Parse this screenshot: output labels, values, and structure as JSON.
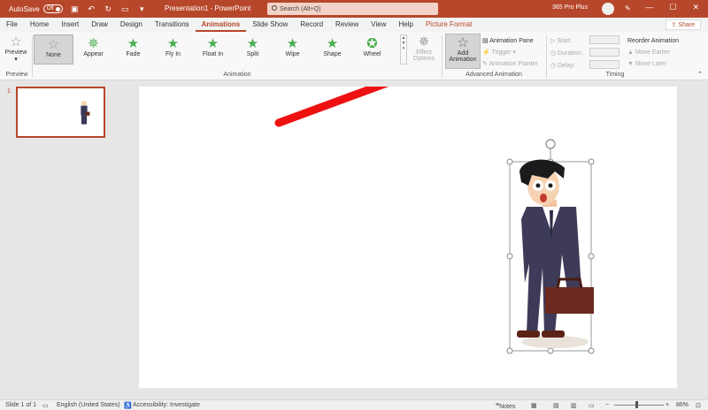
{
  "titlebar": {
    "autosave_label": "AutoSave",
    "autosave_state": "Off",
    "doc_title": "Presentation1 - PowerPoint",
    "search_placeholder": "Search (Alt+Q)",
    "account": "365 Pro Plus",
    "colors": {
      "accent": "#b7472a"
    }
  },
  "tabs": [
    "File",
    "Home",
    "Insert",
    "Draw",
    "Design",
    "Transitions",
    "Animations",
    "Slide Show",
    "Record",
    "Review",
    "View",
    "Help",
    "Picture Format"
  ],
  "active_tab": "Animations",
  "share_label": "Share",
  "ribbon": {
    "preview_label": "Preview",
    "preview_group": "Preview",
    "animations": [
      "None",
      "Appear",
      "Fade",
      "Fly In",
      "Float In",
      "Split",
      "Wipe",
      "Shape",
      "Wheel"
    ],
    "selected_animation": "None",
    "animation_group": "Animation",
    "effect_options": "Effect Options",
    "add_animation": "Add Animation",
    "animation_pane": "Animation Pane",
    "trigger": "Trigger",
    "animation_painter": "Animation Painter",
    "advanced_group": "Advanced Animation",
    "timing": {
      "start": "Start:",
      "duration": "Duration:",
      "delay": "Delay:"
    },
    "reorder": {
      "title": "Reorder Animation",
      "earlier": "Move Earlier",
      "later": "Move Later"
    },
    "timing_group": "Timing"
  },
  "thumbs": {
    "number": "1"
  },
  "status": {
    "slide": "Slide 1 of 1",
    "language": "English (United States)",
    "accessibility": "Accessibility: Investigate",
    "notes": "Notes",
    "zoom": "86%"
  }
}
